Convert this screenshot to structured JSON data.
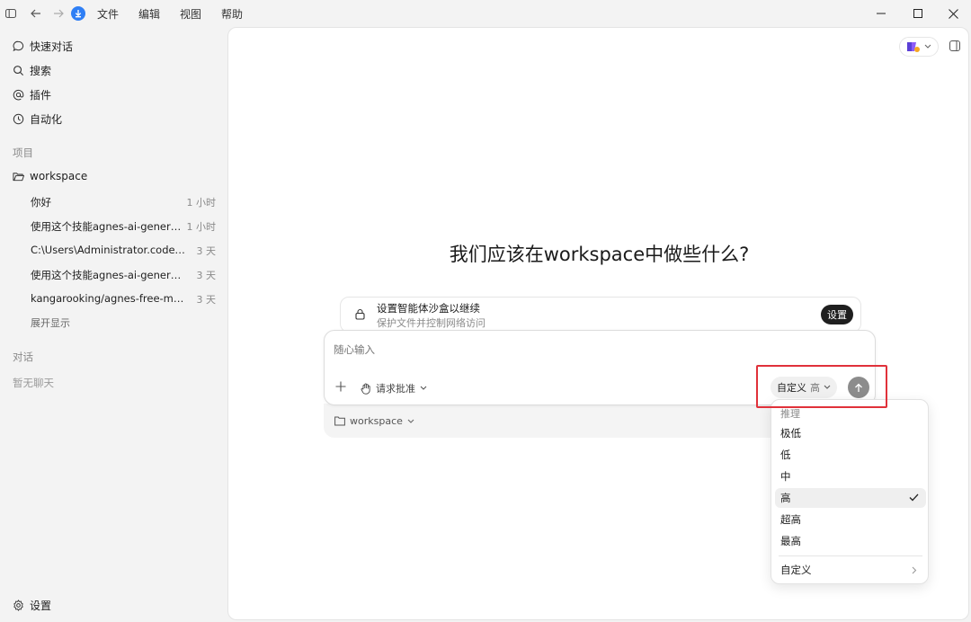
{
  "titlebar": {
    "menu": [
      "文件",
      "编辑",
      "视图",
      "帮助"
    ]
  },
  "sidebar": {
    "nav": [
      {
        "label": "快速对话",
        "icon": "chat-bubble-icon"
      },
      {
        "label": "搜索",
        "icon": "search-icon"
      },
      {
        "label": "插件",
        "icon": "at-sign-icon"
      },
      {
        "label": "自动化",
        "icon": "clock-icon"
      }
    ],
    "projects_label": "项目",
    "workspace": "workspace",
    "threads": [
      {
        "title": "你好",
        "ago": "1 小时"
      },
      {
        "title": "使用这个技能agnes-ai-generati...",
        "ago": "1 小时"
      },
      {
        "title": "C:\\Users\\Administrator.codex\\ski...",
        "ago": "3 天"
      },
      {
        "title": "使用这个技能agnes-ai-generatio...",
        "ago": "3 天"
      },
      {
        "title": "kangarooking/agnes-free-model...",
        "ago": "3 天"
      }
    ],
    "expand": "展开显示",
    "conversations_label": "对话",
    "no_chats": "暂无聊天",
    "settings": "设置"
  },
  "main": {
    "headline": "我们应该在workspace中做些什么?",
    "sandbox": {
      "title": "设置智能体沙盒以继续",
      "subtitle": "保护文件并控制网络访问",
      "button": "设置"
    },
    "composer": {
      "placeholder": "随心输入",
      "approval": "请求批准",
      "mode": "自定义",
      "level": "高"
    },
    "folder": "workspace"
  },
  "dropdown": {
    "header": "推理",
    "items": [
      "极低",
      "低",
      "中",
      "高",
      "超高",
      "最高"
    ],
    "selected": "高",
    "custom": "自定义"
  },
  "colors": {
    "accent": "#2f7ff5",
    "highlight_border": "#e0313a",
    "badge_bg": "#1f1f1f"
  }
}
